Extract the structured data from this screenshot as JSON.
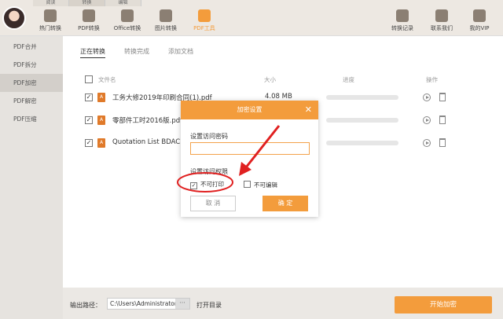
{
  "top_tabs": [
    "阅读",
    "转换",
    "编辑"
  ],
  "nav": [
    {
      "label": "热门转换",
      "icon": "star-icon"
    },
    {
      "label": "PDF转换",
      "icon": "pdf-convert-icon"
    },
    {
      "label": "Office转换",
      "icon": "office-icon"
    },
    {
      "label": "图片转换",
      "icon": "image-icon"
    },
    {
      "label": "PDF工具",
      "icon": "toolbox-icon"
    }
  ],
  "nav_right": [
    {
      "label": "转换记录",
      "icon": "history-icon"
    },
    {
      "label": "联系我们",
      "icon": "contact-icon"
    },
    {
      "label": "我的VIP",
      "icon": "crown-icon"
    }
  ],
  "sidebar": [
    "PDF合并",
    "PDF拆分",
    "PDF加密",
    "PDF解密",
    "PDF压缩"
  ],
  "subtabs": [
    "正在转换",
    "转换完成",
    "添加文档"
  ],
  "table": {
    "headers": [
      "文件名",
      "大小",
      "进度",
      "操作"
    ],
    "rows": [
      {
        "name": "工务大修2019年印刷合同(1).pdf",
        "size": "4.08 MB",
        "checked": "✓"
      },
      {
        "name": "零部件工时2016版.pdf",
        "size": "",
        "checked": "✓"
      },
      {
        "name": "Quotation List BDAC",
        "size": "",
        "checked": "✓"
      }
    ]
  },
  "bottom": {
    "out_label": "输出路径：",
    "path": "C:\\Users\\Administrator",
    "dots": "···",
    "open_dir": "打开目录",
    "start": "开始加密"
  },
  "dialog": {
    "title": "加密设置",
    "close": "✕",
    "password_label": "设置访问密码",
    "password_value": "",
    "perm_label": "设置访问权限",
    "opt_no_print": "不可打印",
    "opt_no_print_mark": "✓",
    "opt_no_edit": "不可编辑",
    "cancel": "取 消",
    "ok": "确 定"
  },
  "colors": {
    "accent": "#f39c3c",
    "annotation": "#e02020"
  }
}
